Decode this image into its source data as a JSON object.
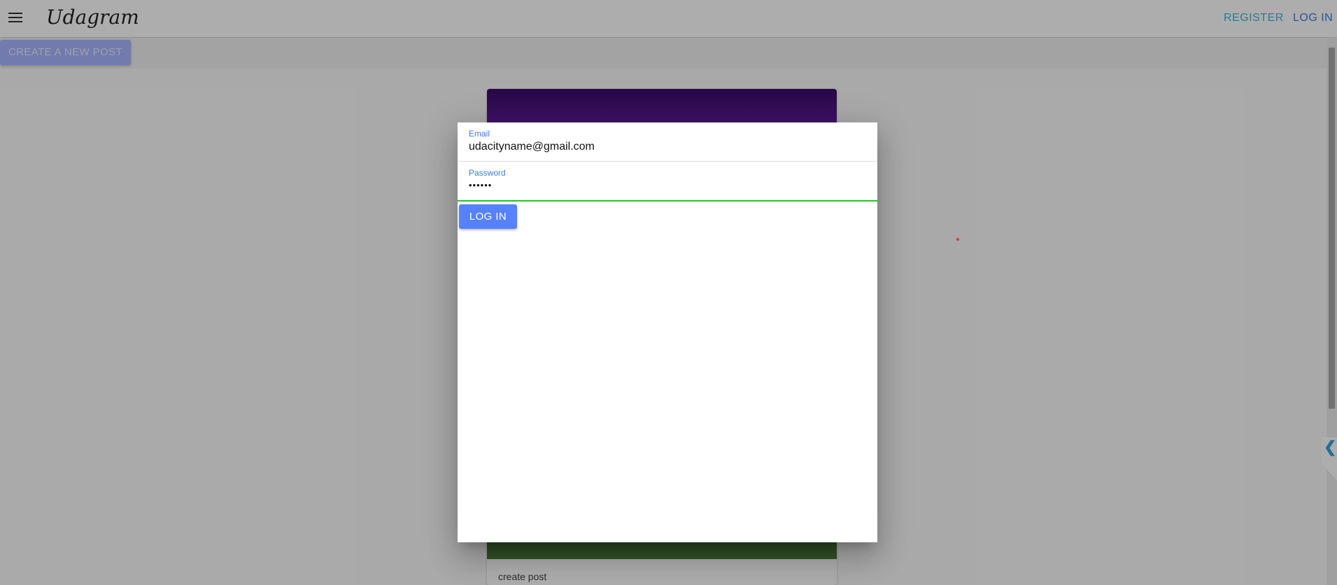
{
  "header": {
    "brand": "Udagram",
    "register_label": "REGISTER",
    "login_label": "LOG IN"
  },
  "actionbar": {
    "create_post_label": "CREATE A NEW POST"
  },
  "feed": {
    "posts": [
      {
        "caption": "create post"
      }
    ]
  },
  "login_modal": {
    "email_label": "Email",
    "email_value": "udacityname@gmail.com",
    "password_label": "Password",
    "password_value": "••••••",
    "submit_label": "LOG IN"
  },
  "side_tab": {
    "icon": "chevron-left-icon",
    "glyph": "❮"
  },
  "colors": {
    "accent": "#5682ff",
    "register_link": "#3fb5d9",
    "login_link": "#3f7be0",
    "focus_underline": "#2dbd2d"
  }
}
